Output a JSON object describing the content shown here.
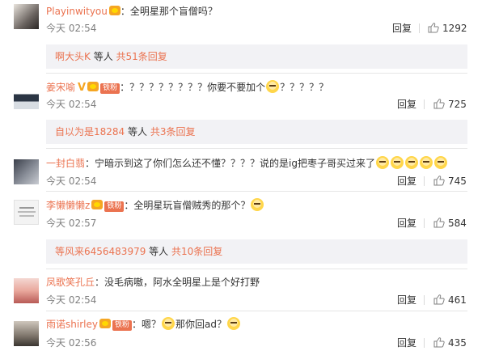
{
  "comments": [
    {
      "username": "Playinwityou",
      "colon": "：",
      "text": "全明星那个盲僧吗？",
      "time": "今天 02:54",
      "reply_label": "回复",
      "likes": "1292",
      "sub": {
        "user": "啊大头K",
        "middle": " 等人 ",
        "more": "共51条回复"
      }
    },
    {
      "username": "姜宋喻",
      "fan_label": "铁粉",
      "colon": "：",
      "text": "？？？？？？？？你要不要加个",
      "text2": "？？？？？",
      "time": "今天 02:54",
      "reply_label": "回复",
      "likes": "725",
      "sub": {
        "user": "自以为是18284",
        "middle": " 等人 ",
        "more": "共3条回复"
      }
    },
    {
      "username": "一封白翡",
      "colon": "：",
      "text": "宁暗示到这了你们怎么还不懂？？？？说的是ig把枣子哥买过来了",
      "time": "今天 02:54",
      "reply_label": "回复",
      "likes": "745"
    },
    {
      "username": "李懒懒懒z",
      "fan_label": "铁粉",
      "colon": "：",
      "text": "全明星玩盲僧贼秀的那个？",
      "time": "今天 02:57",
      "reply_label": "回复",
      "likes": "584",
      "sub": {
        "user": "等风来6456483979",
        "middle": " 等人 ",
        "more": "共10条回复"
      }
    },
    {
      "username": "凤歌笑孔丘",
      "colon": "：",
      "text": "没毛病嗷，阿水全明星上是个好打野",
      "time": "今天 02:54",
      "reply_label": "回复",
      "likes": "461"
    },
    {
      "username": "雨诺shirley",
      "fan_label": "铁粉",
      "colon": "：",
      "text": "嗯？",
      "text2": "那你回ad？",
      "time": "今天 02:56",
      "reply_label": "回复",
      "likes": "435"
    }
  ],
  "colors": {
    "accent": "#eb7350",
    "meta": "#808080",
    "subbox_bg": "#f2f2f5"
  }
}
